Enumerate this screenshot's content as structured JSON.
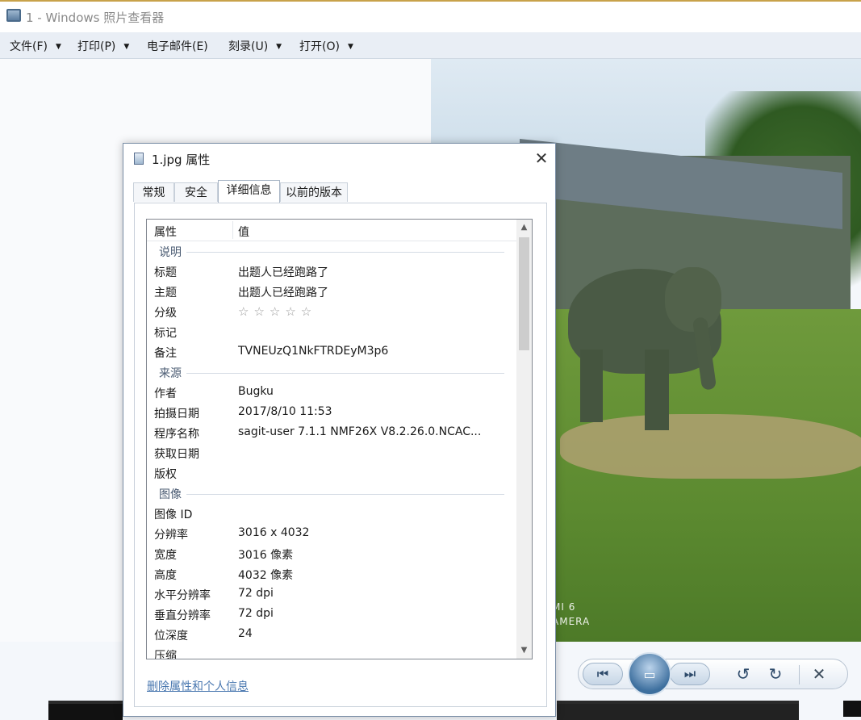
{
  "window": {
    "title": "1 - Windows 照片查看器",
    "icon": "photo-viewer-icon"
  },
  "menu": [
    {
      "label": "文件(F)",
      "has_dropdown": true
    },
    {
      "label": "打印(P)",
      "has_dropdown": true
    },
    {
      "label": "电子邮件(E)",
      "has_dropdown": false
    },
    {
      "label": "刻录(U)",
      "has_dropdown": true
    },
    {
      "label": "打开(O)",
      "has_dropdown": true
    }
  ],
  "photo": {
    "watermark_line1": "MI 6",
    "watermark_line2": "AMERA"
  },
  "dialog": {
    "title": "1.jpg 属性",
    "close_glyph": "✕",
    "tabs": [
      "常规",
      "安全",
      "详细信息",
      "以前的版本"
    ],
    "active_tab": "详细信息",
    "columns": {
      "property": "属性",
      "value": "值"
    },
    "groups": [
      {
        "name": "说明",
        "rows": [
          {
            "key": "标题",
            "value": "出题人已经跑路了"
          },
          {
            "key": "主题",
            "value": "出题人已经跑路了"
          },
          {
            "key": "分级",
            "value": "☆☆☆☆☆"
          },
          {
            "key": "标记",
            "value": ""
          },
          {
            "key": "备注",
            "value": "TVNEUzQ1NkFTRDEyM3p6"
          }
        ]
      },
      {
        "name": "来源",
        "rows": [
          {
            "key": "作者",
            "value": "Bugku"
          },
          {
            "key": "拍摄日期",
            "value": "2017/8/10 11:53"
          },
          {
            "key": "程序名称",
            "value": "sagit-user 7.1.1 NMF26X V8.2.26.0.NCAC..."
          },
          {
            "key": "获取日期",
            "value": ""
          },
          {
            "key": "版权",
            "value": ""
          }
        ]
      },
      {
        "name": "图像",
        "rows": [
          {
            "key": "图像 ID",
            "value": ""
          },
          {
            "key": "分辨率",
            "value": "3016 x 4032"
          },
          {
            "key": "宽度",
            "value": "3016 像素"
          },
          {
            "key": "高度",
            "value": "4032 像素"
          },
          {
            "key": "水平分辨率",
            "value": "72 dpi"
          },
          {
            "key": "垂直分辨率",
            "value": "72 dpi"
          },
          {
            "key": "位深度",
            "value": "24"
          },
          {
            "key": "压缩",
            "value": ""
          }
        ]
      }
    ],
    "remove_link": "删除属性和个人信息"
  },
  "controls": {
    "prev_glyph": "⏮",
    "next_glyph": "⏭",
    "slideshow_glyph": "▭",
    "rotate_left_glyph": "↺",
    "rotate_right_glyph": "↻",
    "delete_glyph": "✕"
  }
}
